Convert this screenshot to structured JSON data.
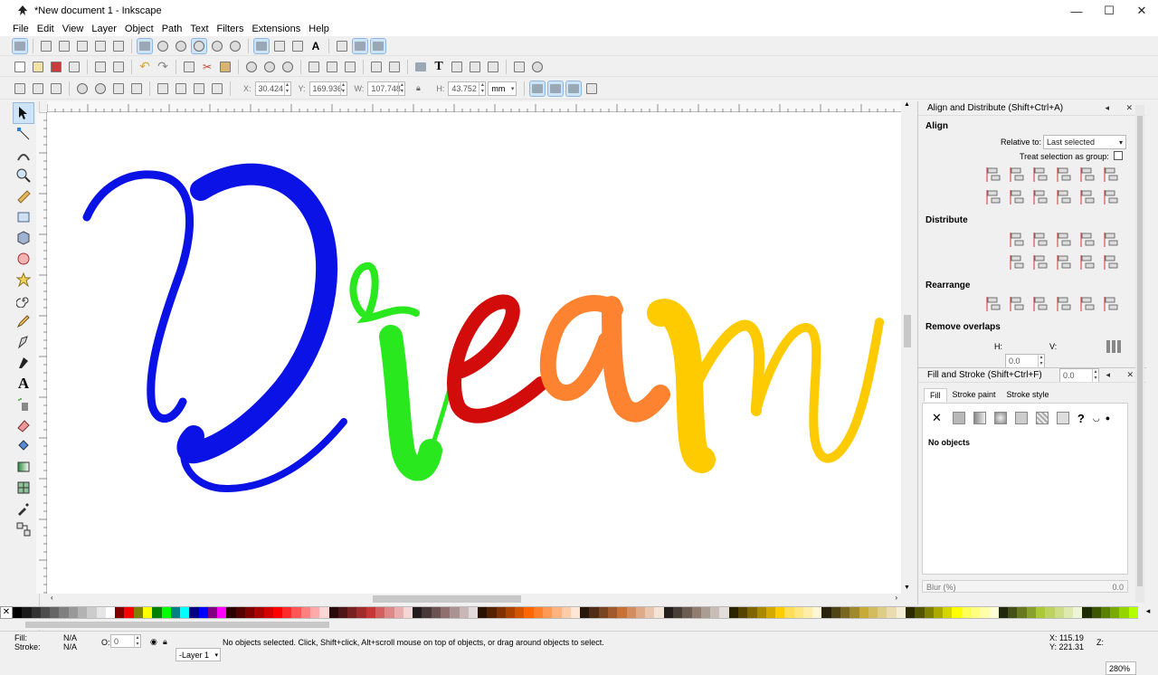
{
  "window": {
    "title": "*New document 1 - Inkscape",
    "minimize": "—",
    "maximize": "☐",
    "close": "✕"
  },
  "menu": [
    "File",
    "Edit",
    "View",
    "Layer",
    "Object",
    "Path",
    "Text",
    "Filters",
    "Extensions",
    "Help"
  ],
  "controls": {
    "x_label": "X:",
    "x_value": "30.424",
    "y_label": "Y:",
    "y_value": "169.936",
    "w_label": "W:",
    "w_value": "107.748",
    "h_label": "H:",
    "h_value": "43.752",
    "unit": "mm"
  },
  "canvas": {
    "artwork": "Dream",
    "letter_colors": [
      "#0b12e6",
      "#29e81d",
      "#d20b0b",
      "#fd8330",
      "#fecb01"
    ]
  },
  "align_panel": {
    "title": "Align and Distribute (Shift+Ctrl+A)",
    "align_heading": "Align",
    "relative_label": "Relative to:",
    "relative_value": "Last selected",
    "treat_group_label": "Treat selection as group:",
    "distribute_heading": "Distribute",
    "rearrange_heading": "Rearrange",
    "overlaps_heading": "Remove overlaps",
    "h_label": "H:",
    "h_value": "0.0",
    "v_label": "V:",
    "v_value": "0.0"
  },
  "fill_panel": {
    "title": "Fill and Stroke (Shift+Ctrl+F)",
    "tabs": [
      "Fill",
      "Stroke paint",
      "Stroke style"
    ],
    "no_objects": "No objects",
    "blur_label": "Blur (%)",
    "blur_value": "0.0"
  },
  "status": {
    "fill_label": "Fill:",
    "fill_value": "N/A",
    "stroke_label": "Stroke:",
    "stroke_value": "N/A",
    "opacity_label": "O:",
    "opacity_value": "0",
    "layer": "-Layer 1",
    "message": "No objects selected. Click, Shift+click, Alt+scroll mouse on top of objects, or drag around objects to select.",
    "x_coord": "X:  115.19",
    "y_coord": "Y:  221.31",
    "zoom_label": "Z:",
    "zoom_value": "280%"
  },
  "palette": [
    "#000000",
    "#1a1a1a",
    "#333333",
    "#4d4d4d",
    "#666666",
    "#808080",
    "#999999",
    "#b3b3b3",
    "#cccccc",
    "#e6e6e6",
    "#ffffff",
    "#800000",
    "#ff0000",
    "#808000",
    "#ffff00",
    "#008000",
    "#00ff00",
    "#008080",
    "#00ffff",
    "#000080",
    "#0000ff",
    "#800080",
    "#ff00ff",
    "#2b0000",
    "#550000",
    "#800000",
    "#aa0000",
    "#d40000",
    "#ff0000",
    "#ff2a2a",
    "#ff5555",
    "#ff8080",
    "#ffaaaa",
    "#ffd5d5",
    "#280b0b",
    "#501616",
    "#782121",
    "#a02c2c",
    "#c83737",
    "#d35f5f",
    "#de8787",
    "#e9afaf",
    "#f4d7d7",
    "#241c1c",
    "#483737",
    "#6c5353",
    "#916f6f",
    "#ac9393",
    "#c8b7b7",
    "#e3dbdb",
    "#2b1100",
    "#552200",
    "#803300",
    "#aa4400",
    "#d45500",
    "#ff6600",
    "#ff7f2a",
    "#ff9955",
    "#ffb380",
    "#ffccaa",
    "#ffe6d5",
    "#28170b",
    "#502d16",
    "#784421",
    "#a05a2c",
    "#c87137",
    "#d38d5f",
    "#deaa87",
    "#e9c6af",
    "#f4e3d7",
    "#241f1c",
    "#483e37",
    "#6c5d53",
    "#917c6f",
    "#ac9d93",
    "#c8beb7",
    "#e3dedb",
    "#2b2200",
    "#554400",
    "#806600",
    "#aa8800",
    "#d4aa00",
    "#ffcc00",
    "#ffdd55",
    "#ffe680",
    "#ffeeaa",
    "#fff6d5",
    "#28220b",
    "#504416",
    "#786721",
    "#a0892c",
    "#c8ab37",
    "#d3bc5f",
    "#decd87",
    "#e9ddaf",
    "#f4eed7",
    "#2b2b00",
    "#555500",
    "#808000",
    "#aaaa00",
    "#d4d400",
    "#ffff00",
    "#ffff55",
    "#ffff80",
    "#ffffaa",
    "#ffffd5",
    "#22280b",
    "#445016",
    "#677821",
    "#89a02c",
    "#abc837",
    "#bcd35f",
    "#cdde87",
    "#dde9af",
    "#eef4d7",
    "#1e2b00",
    "#3c5500",
    "#5a8000",
    "#78aa00",
    "#96d400",
    "#b4ff00"
  ]
}
